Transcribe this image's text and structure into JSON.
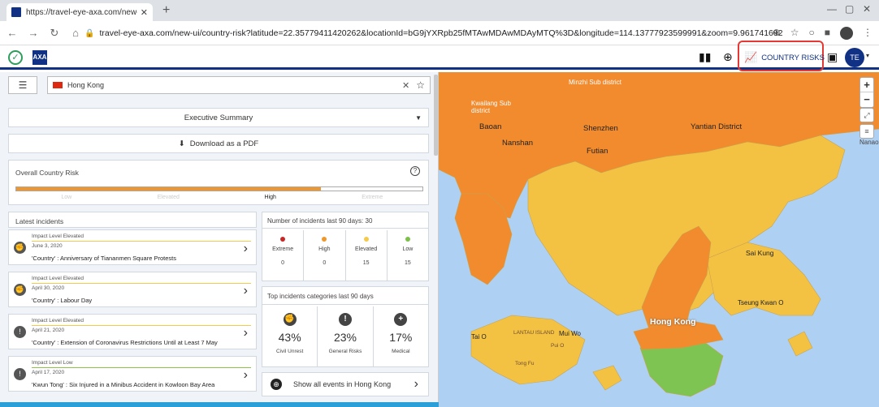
{
  "browser": {
    "tab_title": "https://travel-eye-axa.com/new-",
    "url": "travel-eye-axa.com/new-ui/country-risk?latitude=22.35779411420262&locationId=bG9jYXRpb25fMTAwMDAwMDAyMTQ%3D&longitude=114.13777923599991&zoom=9.961741692..."
  },
  "header": {
    "country_risks_label": "COUNTRY RISKS",
    "avatar_initials": "TE",
    "axa_logo": "AXA"
  },
  "search": {
    "country": "Hong Kong"
  },
  "executive_summary": "Executive Summary",
  "download_label": "Download as a PDF",
  "overall_risk": {
    "title": "Overall Country Risk",
    "levels": [
      "Low",
      "Elevated",
      "High",
      "Extreme"
    ],
    "current_index": 2,
    "fill_fraction": 0.75
  },
  "latest": {
    "title": "Latest incidents",
    "items": [
      {
        "level": "Impact Level Elevated",
        "date": "June 3, 2020",
        "title": "'Country' : Anniversary of Tiananmen Square Protests",
        "color": "#f5c94a"
      },
      {
        "level": "Impact Level Elevated",
        "date": "April 30, 2020",
        "title": "'Country' : Labour Day",
        "color": "#f5c94a"
      },
      {
        "level": "Impact Level Elevated",
        "date": "April 21, 2020",
        "title": "'Country' : Extension of Coronavirus Restrictions Until at Least 7 May",
        "color": "#f5c94a"
      },
      {
        "level": "Impact Level Low",
        "date": "April 17, 2020",
        "title": "'Kwun Tong' : Six Injured in a Minibus Accident in Kowloon Bay Area",
        "color": "#8bc34a"
      }
    ]
  },
  "counts": {
    "title": "Number of incidents last 90 days: 30",
    "items": [
      {
        "label": "Extreme",
        "value": "0",
        "color": "#c62828"
      },
      {
        "label": "High",
        "value": "0",
        "color": "#f0962a"
      },
      {
        "label": "Elevated",
        "value": "15",
        "color": "#f5c94a"
      },
      {
        "label": "Low",
        "value": "15",
        "color": "#7cc04a"
      }
    ]
  },
  "categories": {
    "title": "Top incidents categories last 90 days",
    "items": [
      {
        "pct": "43%",
        "label": "Civil Unrest",
        "icon": "fist-icon"
      },
      {
        "pct": "23%",
        "label": "General Risks",
        "icon": "exclamation-icon"
      },
      {
        "pct": "17%",
        "label": "Medical",
        "icon": "medical-cross-icon"
      }
    ]
  },
  "show_all": "Show all events in Hong Kong",
  "map": {
    "labels": {
      "minzhi": "Minzhi Sub district",
      "kwailang": "Kwailang Sub district",
      "baoan": "Baoan",
      "shenzhen": "Shenzhen",
      "yantian": "Yantian District",
      "nanshan": "Nanshan",
      "futian": "Futian",
      "nanao": "Nanao",
      "saikung": "Sai Kung",
      "tseungkwan": "Tseung Kwan O",
      "hongkong": "Hong Kong",
      "taio": "Tai O",
      "muiwo": "Mui Wo",
      "lantau": "LANTAU ISLAND",
      "pengchau": "Pui O",
      "tonghu": "Tong Fu"
    },
    "colors": {
      "water": "#aed0f2",
      "mainland": "#f28b2e",
      "yellow": "#f4c243",
      "orange_hk": "#f28b2e",
      "green": "#7dc452"
    }
  }
}
